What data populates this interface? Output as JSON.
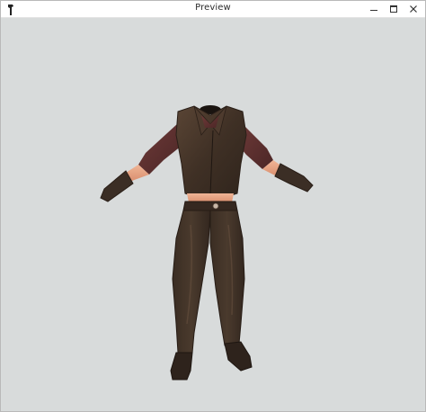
{
  "window": {
    "title": "Preview",
    "controls": {
      "minimize_icon": "minimize-icon",
      "maximize_icon": "maximize-icon",
      "close_icon": "close-icon"
    },
    "app_icon": "app-icon"
  },
  "viewport": {
    "background_color": "#d8dbdb",
    "model": "leather-outfit-3d-model"
  }
}
